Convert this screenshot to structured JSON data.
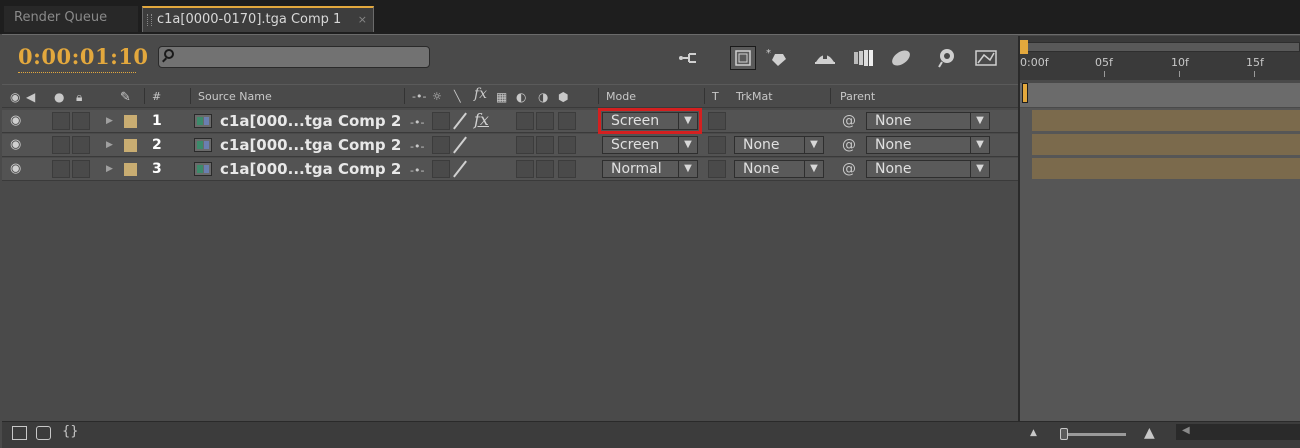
{
  "tabs": {
    "render_queue": "Render Queue",
    "comp": "c1a[0000-0170].tga Comp 1",
    "close": "×"
  },
  "timeline": {
    "timecode": "0:00:01:10",
    "search_placeholder": "",
    "ruler": [
      "0:00f",
      "05f",
      "10f",
      "15f"
    ]
  },
  "toolbar_icons": [
    "composition-mini-flowchart-icon",
    "draft-3d-icon",
    "hide-shy-layers-icon",
    "frame-blending-icon",
    "motion-blur-icon",
    "brainstorm-icon",
    "graph-editor-icon"
  ],
  "columns": {
    "hash": "#",
    "source_name": "Source Name",
    "mode": "Mode",
    "t": "T",
    "trkmat": "TrkMat",
    "parent": "Parent"
  },
  "layers": [
    {
      "num": "1",
      "name": "c1a[000...tga Comp 2",
      "mode": "Screen",
      "trkmat": "",
      "parent": "None",
      "fx": "fx",
      "label_color": "#c9ad72"
    },
    {
      "num": "2",
      "name": "c1a[000...tga Comp 2",
      "mode": "Screen",
      "trkmat": "None",
      "parent": "None",
      "fx": "",
      "label_color": "#c9ad72"
    },
    {
      "num": "3",
      "name": "c1a[000...tga Comp 2",
      "mode": "Normal",
      "trkmat": "None",
      "parent": "None",
      "fx": "",
      "label_color": "#c9ad72"
    }
  ],
  "colors": {
    "accent": "#e3a83d",
    "highlight": "#d42020",
    "layer_bar": "#7b6a4c"
  }
}
